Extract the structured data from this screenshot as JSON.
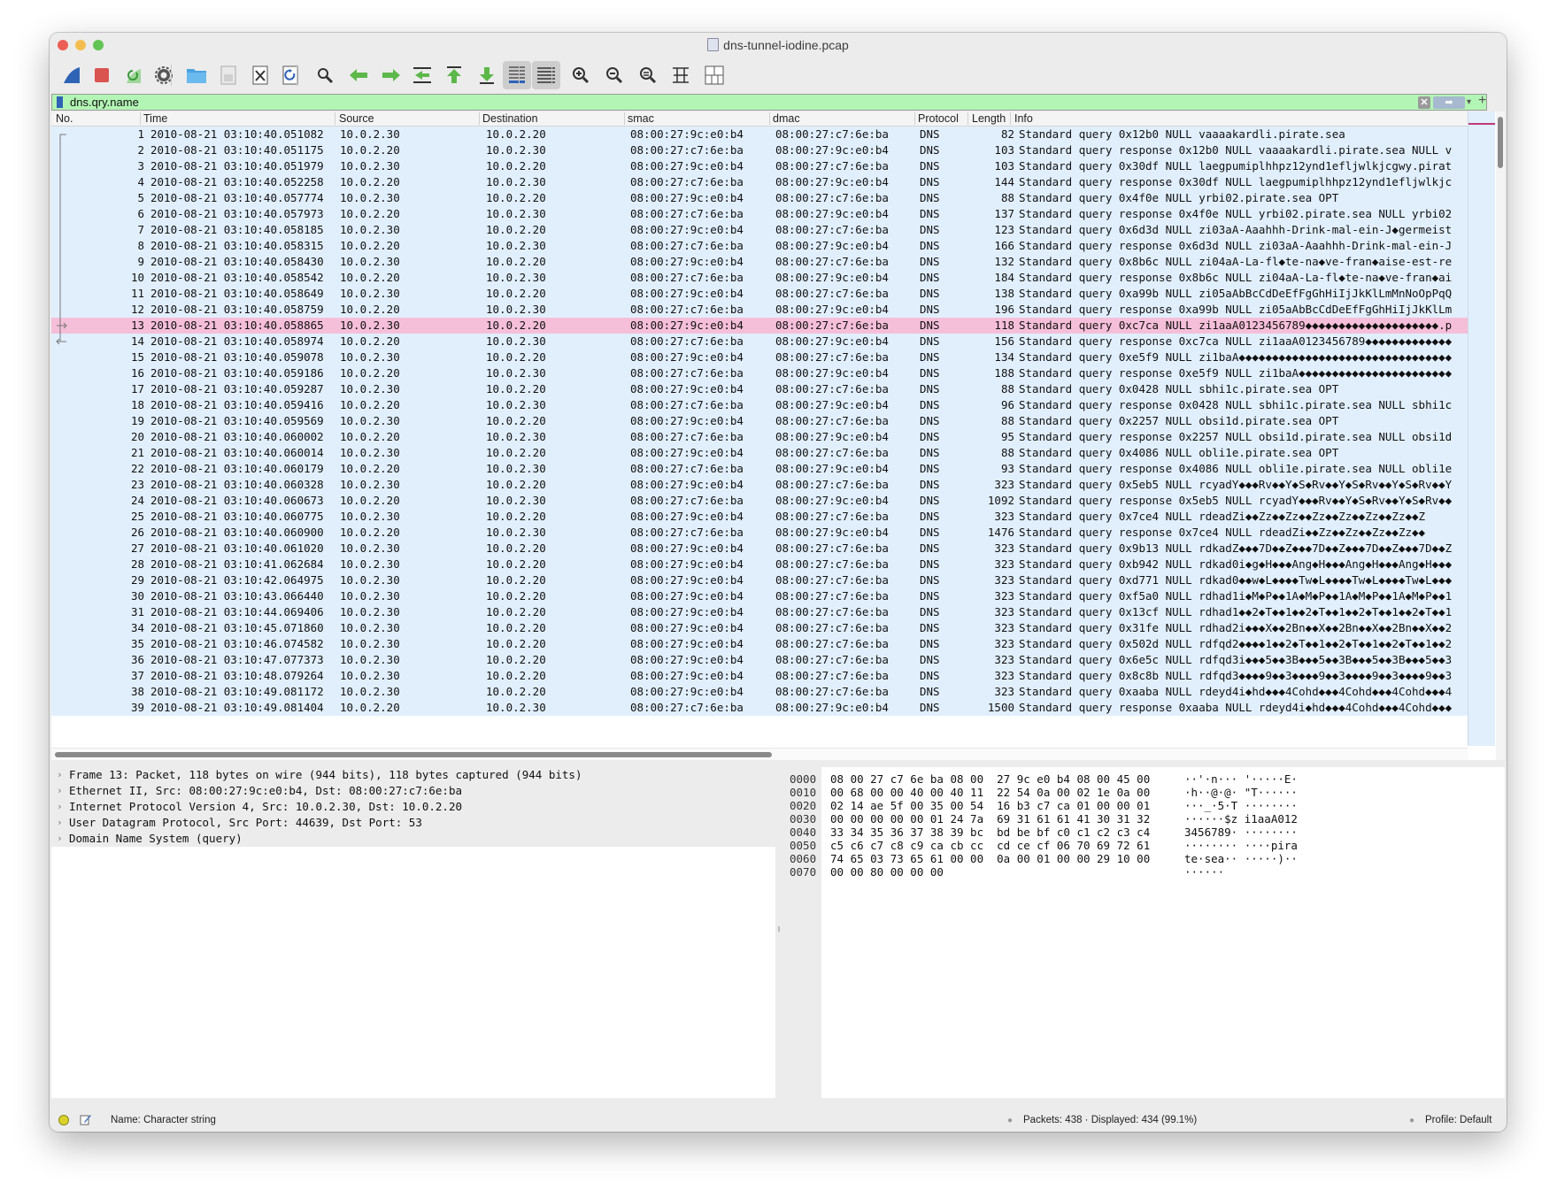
{
  "window": {
    "title": "dns-tunnel-iodine.pcap"
  },
  "toolbar": [
    {
      "name": "shark-fin-start-icon"
    },
    {
      "name": "stop-capture-icon"
    },
    {
      "name": "restart-capture-icon"
    },
    {
      "name": "capture-options-icon"
    },
    {
      "name": "open-file-icon"
    },
    {
      "name": "save-file-icon"
    },
    {
      "name": "close-file-icon"
    },
    {
      "name": "reload-file-icon"
    },
    {
      "name": "find-packet-icon"
    },
    {
      "name": "go-back-icon"
    },
    {
      "name": "go-forward-icon"
    },
    {
      "name": "go-to-packet-icon"
    },
    {
      "name": "go-first-packet-icon"
    },
    {
      "name": "go-last-packet-icon"
    },
    {
      "name": "auto-scroll-icon"
    },
    {
      "name": "colorize-icon"
    },
    {
      "name": "zoom-in-icon"
    },
    {
      "name": "zoom-out-icon"
    },
    {
      "name": "normal-size-icon"
    },
    {
      "name": "resize-columns-icon"
    },
    {
      "name": "layout-icon"
    }
  ],
  "filter": {
    "value": "dns.qry.name",
    "clear_label": "✕",
    "apply_label": "➡",
    "add_label": "+"
  },
  "columns": [
    "No.",
    "Time",
    "Source",
    "Destination",
    "smac",
    "dmac",
    "Protocol",
    "Length",
    "Info"
  ],
  "packets": [
    {
      "no": "1",
      "time": "2010-08-21 03:10:40.051082",
      "src": "10.0.2.30",
      "dst": "10.0.2.20",
      "smac": "08:00:27:9c:e0:b4",
      "dmac": "08:00:27:c7:6e:ba",
      "proto": "DNS",
      "len": "82",
      "info": "Standard query 0x12b0 NULL vaaaakardli.pirate.sea"
    },
    {
      "no": "2",
      "time": "2010-08-21 03:10:40.051175",
      "src": "10.0.2.20",
      "dst": "10.0.2.30",
      "smac": "08:00:27:c7:6e:ba",
      "dmac": "08:00:27:9c:e0:b4",
      "proto": "DNS",
      "len": "103",
      "info": "Standard query response 0x12b0 NULL vaaaakardli.pirate.sea NULL v"
    },
    {
      "no": "3",
      "time": "2010-08-21 03:10:40.051979",
      "src": "10.0.2.30",
      "dst": "10.0.2.20",
      "smac": "08:00:27:9c:e0:b4",
      "dmac": "08:00:27:c7:6e:ba",
      "proto": "DNS",
      "len": "103",
      "info": "Standard query 0x30df NULL laegpumiplhhpz12ynd1efljwlkjcgwy.pirat"
    },
    {
      "no": "4",
      "time": "2010-08-21 03:10:40.052258",
      "src": "10.0.2.20",
      "dst": "10.0.2.30",
      "smac": "08:00:27:c7:6e:ba",
      "dmac": "08:00:27:9c:e0:b4",
      "proto": "DNS",
      "len": "144",
      "info": "Standard query response 0x30df NULL laegpumiplhhpz12ynd1efljwlkjc"
    },
    {
      "no": "5",
      "time": "2010-08-21 03:10:40.057774",
      "src": "10.0.2.30",
      "dst": "10.0.2.20",
      "smac": "08:00:27:9c:e0:b4",
      "dmac": "08:00:27:c7:6e:ba",
      "proto": "DNS",
      "len": "88",
      "info": "Standard query 0x4f0e NULL yrbi02.pirate.sea OPT"
    },
    {
      "no": "6",
      "time": "2010-08-21 03:10:40.057973",
      "src": "10.0.2.20",
      "dst": "10.0.2.30",
      "smac": "08:00:27:c7:6e:ba",
      "dmac": "08:00:27:9c:e0:b4",
      "proto": "DNS",
      "len": "137",
      "info": "Standard query response 0x4f0e NULL yrbi02.pirate.sea NULL yrbi02"
    },
    {
      "no": "7",
      "time": "2010-08-21 03:10:40.058185",
      "src": "10.0.2.30",
      "dst": "10.0.2.20",
      "smac": "08:00:27:9c:e0:b4",
      "dmac": "08:00:27:c7:6e:ba",
      "proto": "DNS",
      "len": "123",
      "info": "Standard query 0x6d3d NULL zi03aA-Aaahhh-Drink-mal-ein-J◆germeist"
    },
    {
      "no": "8",
      "time": "2010-08-21 03:10:40.058315",
      "src": "10.0.2.20",
      "dst": "10.0.2.30",
      "smac": "08:00:27:c7:6e:ba",
      "dmac": "08:00:27:9c:e0:b4",
      "proto": "DNS",
      "len": "166",
      "info": "Standard query response 0x6d3d NULL zi03aA-Aaahhh-Drink-mal-ein-J"
    },
    {
      "no": "9",
      "time": "2010-08-21 03:10:40.058430",
      "src": "10.0.2.30",
      "dst": "10.0.2.20",
      "smac": "08:00:27:9c:e0:b4",
      "dmac": "08:00:27:c7:6e:ba",
      "proto": "DNS",
      "len": "132",
      "info": "Standard query 0x8b6c NULL zi04aA-La-fl◆te-na◆ve-fran◆aise-est-re"
    },
    {
      "no": "10",
      "time": "2010-08-21 03:10:40.058542",
      "src": "10.0.2.20",
      "dst": "10.0.2.30",
      "smac": "08:00:27:c7:6e:ba",
      "dmac": "08:00:27:9c:e0:b4",
      "proto": "DNS",
      "len": "184",
      "info": "Standard query response 0x8b6c NULL zi04aA-La-fl◆te-na◆ve-fran◆ai"
    },
    {
      "no": "11",
      "time": "2010-08-21 03:10:40.058649",
      "src": "10.0.2.30",
      "dst": "10.0.2.20",
      "smac": "08:00:27:9c:e0:b4",
      "dmac": "08:00:27:c7:6e:ba",
      "proto": "DNS",
      "len": "138",
      "info": "Standard query 0xa99b NULL zi05aAbBcCdDeEfFgGhHiIjJkKlLmMnNoOpPqQ"
    },
    {
      "no": "12",
      "time": "2010-08-21 03:10:40.058759",
      "src": "10.0.2.20",
      "dst": "10.0.2.30",
      "smac": "08:00:27:c7:6e:ba",
      "dmac": "08:00:27:9c:e0:b4",
      "proto": "DNS",
      "len": "196",
      "info": "Standard query response 0xa99b NULL zi05aAbBcCdDeEfFgGhHiIjJkKlLm"
    },
    {
      "no": "13",
      "time": "2010-08-21 03:10:40.058865",
      "src": "10.0.2.30",
      "dst": "10.0.2.20",
      "smac": "08:00:27:9c:e0:b4",
      "dmac": "08:00:27:c7:6e:ba",
      "proto": "DNS",
      "len": "118",
      "info": "Standard query 0xc7ca NULL zi1aaA0123456789◆◆◆◆◆◆◆◆◆◆◆◆◆◆◆◆◆◆◆◆.p"
    },
    {
      "no": "14",
      "time": "2010-08-21 03:10:40.058974",
      "src": "10.0.2.20",
      "dst": "10.0.2.30",
      "smac": "08:00:27:c7:6e:ba",
      "dmac": "08:00:27:9c:e0:b4",
      "proto": "DNS",
      "len": "156",
      "info": "Standard query response 0xc7ca NULL zi1aaA0123456789◆◆◆◆◆◆◆◆◆◆◆◆◆"
    },
    {
      "no": "15",
      "time": "2010-08-21 03:10:40.059078",
      "src": "10.0.2.30",
      "dst": "10.0.2.20",
      "smac": "08:00:27:9c:e0:b4",
      "dmac": "08:00:27:c7:6e:ba",
      "proto": "DNS",
      "len": "134",
      "info": "Standard query 0xe5f9 NULL zi1baA◆◆◆◆◆◆◆◆◆◆◆◆◆◆◆◆◆◆◆◆◆◆◆◆◆◆◆◆◆◆◆◆"
    },
    {
      "no": "16",
      "time": "2010-08-21 03:10:40.059186",
      "src": "10.0.2.20",
      "dst": "10.0.2.30",
      "smac": "08:00:27:c7:6e:ba",
      "dmac": "08:00:27:9c:e0:b4",
      "proto": "DNS",
      "len": "188",
      "info": "Standard query response 0xe5f9 NULL zi1baA◆◆◆◆◆◆◆◆◆◆◆◆◆◆◆◆◆◆◆◆◆◆◆"
    },
    {
      "no": "17",
      "time": "2010-08-21 03:10:40.059287",
      "src": "10.0.2.30",
      "dst": "10.0.2.20",
      "smac": "08:00:27:9c:e0:b4",
      "dmac": "08:00:27:c7:6e:ba",
      "proto": "DNS",
      "len": "88",
      "info": "Standard query 0x0428 NULL sbhi1c.pirate.sea OPT"
    },
    {
      "no": "18",
      "time": "2010-08-21 03:10:40.059416",
      "src": "10.0.2.20",
      "dst": "10.0.2.30",
      "smac": "08:00:27:c7:6e:ba",
      "dmac": "08:00:27:9c:e0:b4",
      "proto": "DNS",
      "len": "96",
      "info": "Standard query response 0x0428 NULL sbhi1c.pirate.sea NULL sbhi1c"
    },
    {
      "no": "19",
      "time": "2010-08-21 03:10:40.059569",
      "src": "10.0.2.30",
      "dst": "10.0.2.20",
      "smac": "08:00:27:9c:e0:b4",
      "dmac": "08:00:27:c7:6e:ba",
      "proto": "DNS",
      "len": "88",
      "info": "Standard query 0x2257 NULL obsi1d.pirate.sea OPT"
    },
    {
      "no": "20",
      "time": "2010-08-21 03:10:40.060002",
      "src": "10.0.2.20",
      "dst": "10.0.2.30",
      "smac": "08:00:27:c7:6e:ba",
      "dmac": "08:00:27:9c:e0:b4",
      "proto": "DNS",
      "len": "95",
      "info": "Standard query response 0x2257 NULL obsi1d.pirate.sea NULL obsi1d"
    },
    {
      "no": "21",
      "time": "2010-08-21 03:10:40.060014",
      "src": "10.0.2.30",
      "dst": "10.0.2.20",
      "smac": "08:00:27:9c:e0:b4",
      "dmac": "08:00:27:c7:6e:ba",
      "proto": "DNS",
      "len": "88",
      "info": "Standard query 0x4086 NULL obli1e.pirate.sea OPT"
    },
    {
      "no": "22",
      "time": "2010-08-21 03:10:40.060179",
      "src": "10.0.2.20",
      "dst": "10.0.2.30",
      "smac": "08:00:27:c7:6e:ba",
      "dmac": "08:00:27:9c:e0:b4",
      "proto": "DNS",
      "len": "93",
      "info": "Standard query response 0x4086 NULL obli1e.pirate.sea NULL obli1e"
    },
    {
      "no": "23",
      "time": "2010-08-21 03:10:40.060328",
      "src": "10.0.2.30",
      "dst": "10.0.2.20",
      "smac": "08:00:27:9c:e0:b4",
      "dmac": "08:00:27:c7:6e:ba",
      "proto": "DNS",
      "len": "323",
      "info": "Standard query 0x5eb5 NULL rcyadY◆◆◆Rv◆◆Y◆S◆Rv◆◆Y◆S◆Rv◆◆Y◆S◆Rv◆◆Y"
    },
    {
      "no": "24",
      "time": "2010-08-21 03:10:40.060673",
      "src": "10.0.2.20",
      "dst": "10.0.2.30",
      "smac": "08:00:27:c7:6e:ba",
      "dmac": "08:00:27:9c:e0:b4",
      "proto": "DNS",
      "len": "1092",
      "info": "Standard query response 0x5eb5 NULL rcyadY◆◆◆Rv◆◆Y◆S◆Rv◆◆Y◆S◆Rv◆◆"
    },
    {
      "no": "25",
      "time": "2010-08-21 03:10:40.060775",
      "src": "10.0.2.30",
      "dst": "10.0.2.20",
      "smac": "08:00:27:9c:e0:b4",
      "dmac": "08:00:27:c7:6e:ba",
      "proto": "DNS",
      "len": "323",
      "info": "Standard query 0x7ce4 NULL rdeadZi◆◆Zz◆◆Zz◆◆Zz◆◆Zz◆◆Zz◆◆Zz◆◆Z"
    },
    {
      "no": "26",
      "time": "2010-08-21 03:10:40.060900",
      "src": "10.0.2.20",
      "dst": "10.0.2.30",
      "smac": "08:00:27:c7:6e:ba",
      "dmac": "08:00:27:9c:e0:b4",
      "proto": "DNS",
      "len": "1476",
      "info": "Standard query response 0x7ce4 NULL rdeadZi◆◆Zz◆◆Zz◆◆Zz◆◆Zz◆◆"
    },
    {
      "no": "27",
      "time": "2010-08-21 03:10:40.061020",
      "src": "10.0.2.30",
      "dst": "10.0.2.20",
      "smac": "08:00:27:9c:e0:b4",
      "dmac": "08:00:27:c7:6e:ba",
      "proto": "DNS",
      "len": "323",
      "info": "Standard query 0x9b13 NULL rdkadZ◆◆◆7D◆◆Z◆◆◆7D◆◆Z◆◆◆7D◆◆Z◆◆◆7D◆◆Z"
    },
    {
      "no": "28",
      "time": "2010-08-21 03:10:41.062684",
      "src": "10.0.2.30",
      "dst": "10.0.2.20",
      "smac": "08:00:27:9c:e0:b4",
      "dmac": "08:00:27:c7:6e:ba",
      "proto": "DNS",
      "len": "323",
      "info": "Standard query 0xb942 NULL rdkad0i◆g◆H◆◆◆Ang◆H◆◆◆Ang◆H◆◆◆Ang◆H◆◆◆"
    },
    {
      "no": "29",
      "time": "2010-08-21 03:10:42.064975",
      "src": "10.0.2.30",
      "dst": "10.0.2.20",
      "smac": "08:00:27:9c:e0:b4",
      "dmac": "08:00:27:c7:6e:ba",
      "proto": "DNS",
      "len": "323",
      "info": "Standard query 0xd771 NULL rdkad0◆◆w◆L◆◆◆◆Tw◆L◆◆◆◆Tw◆L◆◆◆◆Tw◆L◆◆◆"
    },
    {
      "no": "30",
      "time": "2010-08-21 03:10:43.066440",
      "src": "10.0.2.30",
      "dst": "10.0.2.20",
      "smac": "08:00:27:9c:e0:b4",
      "dmac": "08:00:27:c7:6e:ba",
      "proto": "DNS",
      "len": "323",
      "info": "Standard query 0xf5a0 NULL rdhad1i◆M◆P◆◆1A◆M◆P◆◆1A◆M◆P◆◆1A◆M◆P◆◆1"
    },
    {
      "no": "31",
      "time": "2010-08-21 03:10:44.069406",
      "src": "10.0.2.30",
      "dst": "10.0.2.20",
      "smac": "08:00:27:9c:e0:b4",
      "dmac": "08:00:27:c7:6e:ba",
      "proto": "DNS",
      "len": "323",
      "info": "Standard query 0x13cf NULL rdhad1◆◆2◆T◆◆1◆◆2◆T◆◆1◆◆2◆T◆◆1◆◆2◆T◆◆1"
    },
    {
      "no": "34",
      "time": "2010-08-21 03:10:45.071860",
      "src": "10.0.2.30",
      "dst": "10.0.2.20",
      "smac": "08:00:27:9c:e0:b4",
      "dmac": "08:00:27:c7:6e:ba",
      "proto": "DNS",
      "len": "323",
      "info": "Standard query 0x31fe NULL rdhad2i◆◆◆X◆◆2Bn◆◆X◆◆2Bn◆◆X◆◆2Bn◆◆X◆◆2"
    },
    {
      "no": "35",
      "time": "2010-08-21 03:10:46.074582",
      "src": "10.0.2.30",
      "dst": "10.0.2.20",
      "smac": "08:00:27:9c:e0:b4",
      "dmac": "08:00:27:c7:6e:ba",
      "proto": "DNS",
      "len": "323",
      "info": "Standard query 0x502d NULL rdfqd2◆◆◆◆1◆◆2◆T◆◆1◆◆2◆T◆◆1◆◆2◆T◆◆1◆◆2"
    },
    {
      "no": "36",
      "time": "2010-08-21 03:10:47.077373",
      "src": "10.0.2.30",
      "dst": "10.0.2.20",
      "smac": "08:00:27:9c:e0:b4",
      "dmac": "08:00:27:c7:6e:ba",
      "proto": "DNS",
      "len": "323",
      "info": "Standard query 0x6e5c NULL rdfqd3i◆◆◆5◆◆3B◆◆◆5◆◆3B◆◆◆5◆◆3B◆◆◆5◆◆3"
    },
    {
      "no": "37",
      "time": "2010-08-21 03:10:48.079264",
      "src": "10.0.2.30",
      "dst": "10.0.2.20",
      "smac": "08:00:27:9c:e0:b4",
      "dmac": "08:00:27:c7:6e:ba",
      "proto": "DNS",
      "len": "323",
      "info": "Standard query 0x8c8b NULL rdfqd3◆◆◆◆9◆◆3◆◆◆◆9◆◆3◆◆◆◆9◆◆3◆◆◆◆9◆◆3"
    },
    {
      "no": "38",
      "time": "2010-08-21 03:10:49.081172",
      "src": "10.0.2.30",
      "dst": "10.0.2.20",
      "smac": "08:00:27:9c:e0:b4",
      "dmac": "08:00:27:c7:6e:ba",
      "proto": "DNS",
      "len": "323",
      "info": "Standard query 0xaaba NULL rdeyd4i◆hd◆◆◆4Cohd◆◆◆4Cohd◆◆◆4Cohd◆◆◆4"
    },
    {
      "no": "39",
      "time": "2010-08-21 03:10:49.081404",
      "src": "10.0.2.20",
      "dst": "10.0.2.30",
      "smac": "08:00:27:c7:6e:ba",
      "dmac": "08:00:27:9c:e0:b4",
      "proto": "DNS",
      "len": "1500",
      "info": "Standard query response 0xaaba NULL rdeyd4i◆hd◆◆◆4Cohd◆◆◆4Cohd◆◆◆"
    }
  ],
  "selected_packet": "13",
  "details": [
    "Frame 13: Packet, 118 bytes on wire (944 bits), 118 bytes captured (944 bits)",
    "Ethernet II, Src: 08:00:27:9c:e0:b4, Dst: 08:00:27:c7:6e:ba",
    "Internet Protocol Version 4, Src: 10.0.2.30, Dst: 10.0.2.20",
    "User Datagram Protocol, Src Port: 44639, Dst Port: 53",
    "Domain Name System (query)"
  ],
  "bytes": [
    {
      "offset": "0000",
      "hex": "08 00 27 c7 6e ba 08 00  27 9c e0 b4 08 00 45 00",
      "ascii": "··'·n··· '·····E·"
    },
    {
      "offset": "0010",
      "hex": "00 68 00 00 40 00 40 11  22 54 0a 00 02 1e 0a 00",
      "ascii": "·h··@·@· \"T······"
    },
    {
      "offset": "0020",
      "hex": "02 14 ae 5f 00 35 00 54  16 b3 c7 ca 01 00 00 01",
      "ascii": "···_·5·T ········"
    },
    {
      "offset": "0030",
      "hex": "00 00 00 00 00 01 24 7a  69 31 61 61 41 30 31 32",
      "ascii": "······$z i1aaA012"
    },
    {
      "offset": "0040",
      "hex": "33 34 35 36 37 38 39 bc  bd be bf c0 c1 c2 c3 c4",
      "ascii": "3456789· ········"
    },
    {
      "offset": "0050",
      "hex": "c5 c6 c7 c8 c9 ca cb cc  cd ce cf 06 70 69 72 61",
      "ascii": "········ ····pira"
    },
    {
      "offset": "0060",
      "hex": "74 65 03 73 65 61 00 00  0a 00 01 00 00 29 10 00",
      "ascii": "te·sea·· ·····)··"
    },
    {
      "offset": "0070",
      "hex": "00 00 80 00 00 00",
      "ascii": "······"
    }
  ],
  "status": {
    "field_name": "Name: Character string",
    "packets": "Packets: 438 · Displayed: 434 (99.1%)",
    "profile": "Profile: Default"
  },
  "colors": {
    "row_bg": "#e1effd",
    "selected_bg": "#f6bfd9",
    "filter_bg": "#b2f5b4",
    "accent_blue": "#2f63b5"
  }
}
